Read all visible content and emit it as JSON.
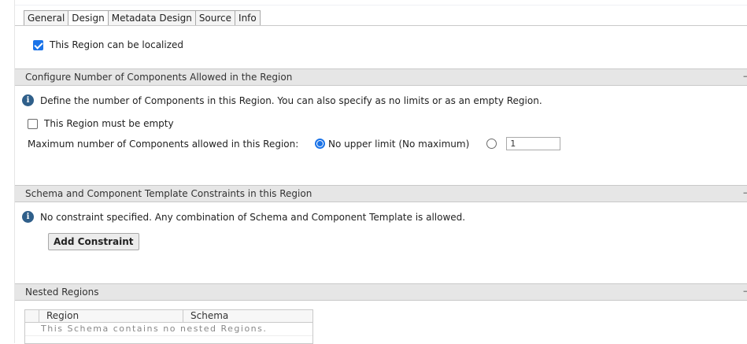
{
  "tabs": [
    {
      "label": "General",
      "active": false
    },
    {
      "label": "Design",
      "active": true
    },
    {
      "label": "Metadata Design",
      "active": false
    },
    {
      "label": "Source",
      "active": false
    },
    {
      "label": "Info",
      "active": false
    }
  ],
  "localize": {
    "label": "This Region can be localized",
    "checked": true
  },
  "components_section": {
    "title": "Configure Number of Components Allowed in the Region",
    "info": "Define the number of Components in this Region. You can also specify as no limits or as an empty Region.",
    "empty_label": "This Region must be empty",
    "empty_checked": false,
    "max_label": "Maximum number of Components allowed in this Region:",
    "no_limit_label": "No upper limit (No maximum)",
    "no_limit_selected": true,
    "max_value": "1"
  },
  "constraints_section": {
    "title": "Schema and Component Template Constraints in this Region",
    "info": "No constraint specified. Any combination of Schema and Component Template is allowed.",
    "add_button": "Add Constraint"
  },
  "nested_section": {
    "title": "Nested Regions",
    "columns": [
      "Region",
      "Schema"
    ],
    "empty_message": "This Schema contains no nested Regions."
  },
  "colors": {
    "accent": "#1a73e8",
    "info_icon": "#2f5f8a",
    "header_bg": "#e6e6e6"
  }
}
